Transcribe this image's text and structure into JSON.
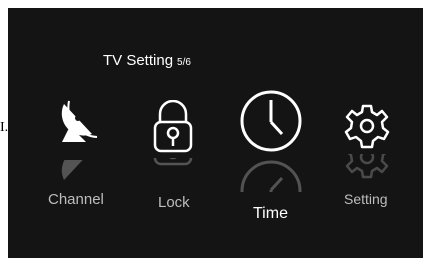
{
  "header": {
    "title": "TV Setting",
    "page": "5/6"
  },
  "menu": {
    "items": [
      {
        "label": "Channel",
        "icon": "satellite-dish-icon",
        "selected": false
      },
      {
        "label": "Lock",
        "icon": "padlock-icon",
        "selected": false
      },
      {
        "label": "Time",
        "icon": "clock-icon",
        "selected": true
      },
      {
        "label": "Setting",
        "icon": "gear-icon",
        "selected": false
      }
    ]
  },
  "colors": {
    "background": "#141414",
    "text": "#ffffff",
    "dim_text": "#bdbdbd"
  }
}
